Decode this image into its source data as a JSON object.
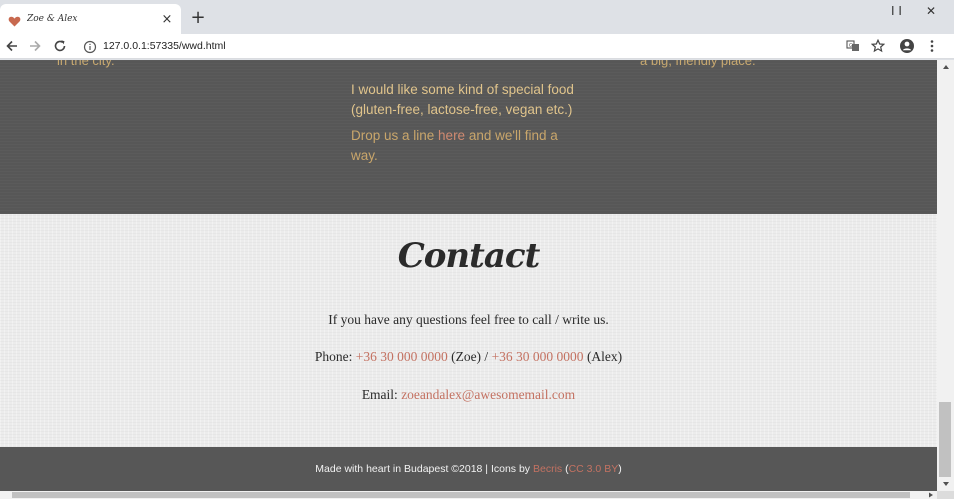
{
  "browser": {
    "tab": {
      "title": "Zoe & Alex",
      "close_glyph": "×"
    },
    "new_tab_glyph": "+",
    "window_controls": {
      "minimize_glyph": "I I",
      "close_glyph": "✕"
    },
    "address": {
      "url": "127.0.0.1:57335/wwd.html"
    },
    "icons": [
      "back-icon",
      "forward-icon",
      "reload-icon",
      "info-icon",
      "translate-icon",
      "star-icon",
      "profile-icon",
      "menu-icon"
    ]
  },
  "page": {
    "cut_left": "in the city.",
    "cut_right": "a big, friendly place.",
    "food": {
      "question": "I would like some kind of special food (gluten-free, lactose-free, vegan etc.)",
      "answer_before": "Drop us a line ",
      "answer_link": "here",
      "answer_after": " and we'll find a way."
    },
    "contact": {
      "title": "Contact",
      "intro": "If you have any questions feel free to call / write us.",
      "phone_label": "Phone: ",
      "phone_zoe": "+36 30 000 0000",
      "phone_zoe_name": " (Zoe) / ",
      "phone_alex": "+36 30 000 0000",
      "phone_alex_name": " (Alex)",
      "email_label": "Email: ",
      "email": "zoeandalex@awesomemail.com"
    },
    "footer": {
      "text": "Made with heart in Budapest ©2018 | Icons by ",
      "icons_author": "Becris",
      "paren_open": " (",
      "license": "CC 3.0 BY",
      "paren_close": ")"
    }
  },
  "colors": {
    "dark_bg": "#575757",
    "gold_text": "#e0c48c",
    "link": "#c47262",
    "light_bg": "#ececec"
  }
}
